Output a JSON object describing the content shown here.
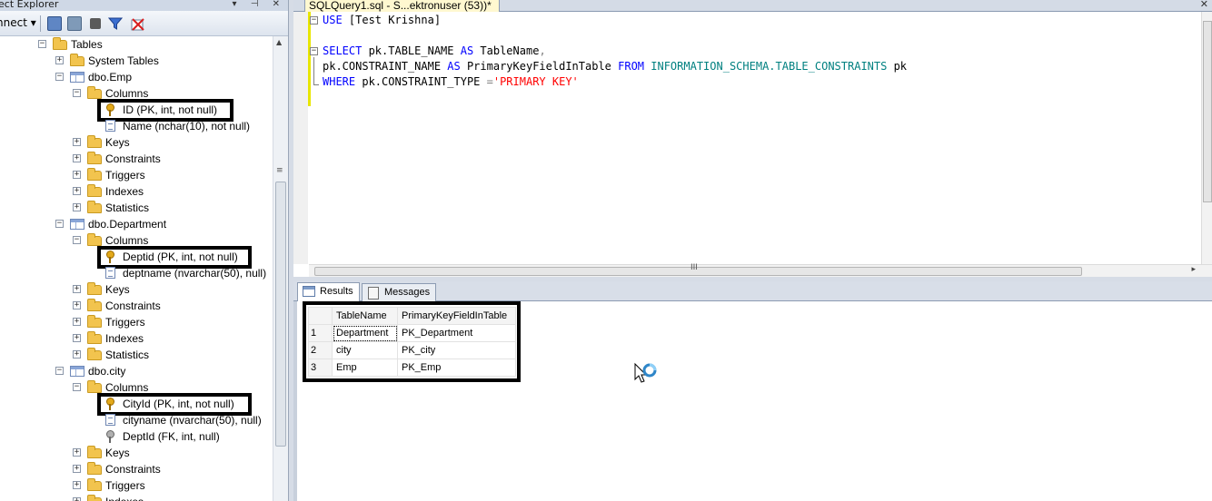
{
  "object_explorer": {
    "title": "ect Explorer",
    "connect_label": "nnect ▾",
    "pin_glyphs": "▾ ⊣ ✕",
    "tree": [
      {
        "label": "Tables",
        "icon": "folder-icon",
        "expander": "−"
      },
      {
        "label": "System Tables",
        "icon": "folder-icon",
        "expander": "+"
      },
      {
        "label": "dbo.Emp",
        "icon": "table-icon",
        "expander": "−"
      },
      {
        "label": "Columns",
        "icon": "folder-icon",
        "expander": "−"
      },
      {
        "label": "ID (PK, int, not null)",
        "icon": "primary-key-icon",
        "expander": ""
      },
      {
        "label": "Name (nchar(10), not null)",
        "icon": "column-icon",
        "expander": ""
      },
      {
        "label": "Keys",
        "icon": "folder-icon",
        "expander": "+"
      },
      {
        "label": "Constraints",
        "icon": "folder-icon",
        "expander": "+"
      },
      {
        "label": "Triggers",
        "icon": "folder-icon",
        "expander": "+"
      },
      {
        "label": "Indexes",
        "icon": "folder-icon",
        "expander": "+"
      },
      {
        "label": "Statistics",
        "icon": "folder-icon",
        "expander": "+"
      },
      {
        "label": "dbo.Department",
        "icon": "table-icon",
        "expander": "−"
      },
      {
        "label": "Columns",
        "icon": "folder-icon",
        "expander": "−"
      },
      {
        "label": "Deptid (PK, int, not null)",
        "icon": "primary-key-icon",
        "expander": ""
      },
      {
        "label": "deptname (nvarchar(50), null)",
        "icon": "column-icon",
        "expander": ""
      },
      {
        "label": "Keys",
        "icon": "folder-icon",
        "expander": "+"
      },
      {
        "label": "Constraints",
        "icon": "folder-icon",
        "expander": "+"
      },
      {
        "label": "Triggers",
        "icon": "folder-icon",
        "expander": "+"
      },
      {
        "label": "Indexes",
        "icon": "folder-icon",
        "expander": "+"
      },
      {
        "label": "Statistics",
        "icon": "folder-icon",
        "expander": "+"
      },
      {
        "label": "dbo.city",
        "icon": "table-icon",
        "expander": "−"
      },
      {
        "label": "Columns",
        "icon": "folder-icon",
        "expander": "−"
      },
      {
        "label": "CityId (PK, int, not null)",
        "icon": "primary-key-icon",
        "expander": ""
      },
      {
        "label": "cityname (nvarchar(50), null)",
        "icon": "column-icon",
        "expander": ""
      },
      {
        "label": "DeptId (FK, int, null)",
        "icon": "foreign-key-icon",
        "expander": ""
      },
      {
        "label": "Keys",
        "icon": "folder-icon",
        "expander": "+"
      },
      {
        "label": "Constraints",
        "icon": "folder-icon",
        "expander": "+"
      },
      {
        "label": "Triggers",
        "icon": "folder-icon",
        "expander": "+"
      },
      {
        "label": "Indexes",
        "icon": "folder-icon",
        "expander": "+"
      }
    ]
  },
  "editor": {
    "tab_title": "SQLQuery1.sql - S...ektronuser (53))*",
    "close_glyph": "✕",
    "lines": {
      "l1_kw": "USE",
      "l1_rest": " [Test Krishna]",
      "l3_kw1": "SELECT",
      "l3_mid": " pk.TABLE_NAME ",
      "l3_kw2": "AS",
      "l3_rest": " TableName",
      "l3_comma": ",",
      "l4_a": "pk.CONSTRAINT_NAME ",
      "l4_kw1": "AS",
      "l4_b": " PrimaryKeyFieldInTable ",
      "l4_kw2": "FROM",
      "l4_obj": " INFORMATION_SCHEMA.TABLE_CONSTRAINTS",
      "l4_c": " pk",
      "l5_kw": "WHERE",
      "l5_a": " pk.CONSTRAINT_TYPE ",
      "l5_op": "=",
      "l5_str": "'PRIMARY KEY'"
    },
    "scroll_grip": "III",
    "scroll_right": "▸"
  },
  "results": {
    "tabs": [
      {
        "label": "Results",
        "active": true
      },
      {
        "label": "Messages",
        "active": false
      }
    ],
    "columns": [
      "TableName",
      "PrimaryKeyFieldInTable"
    ],
    "rows": [
      {
        "n": "1",
        "TableName": "Department",
        "PrimaryKeyFieldInTable": "PK_Department"
      },
      {
        "n": "2",
        "TableName": "city",
        "PrimaryKeyFieldInTable": "PK_city"
      },
      {
        "n": "3",
        "TableName": "Emp",
        "PrimaryKeyFieldInTable": "PK_Emp"
      }
    ]
  },
  "colors": {
    "keyword": "#0000ff",
    "system_object": "#008080",
    "string": "#ff0000",
    "operator": "#808080",
    "highlight_box": "#000000"
  }
}
